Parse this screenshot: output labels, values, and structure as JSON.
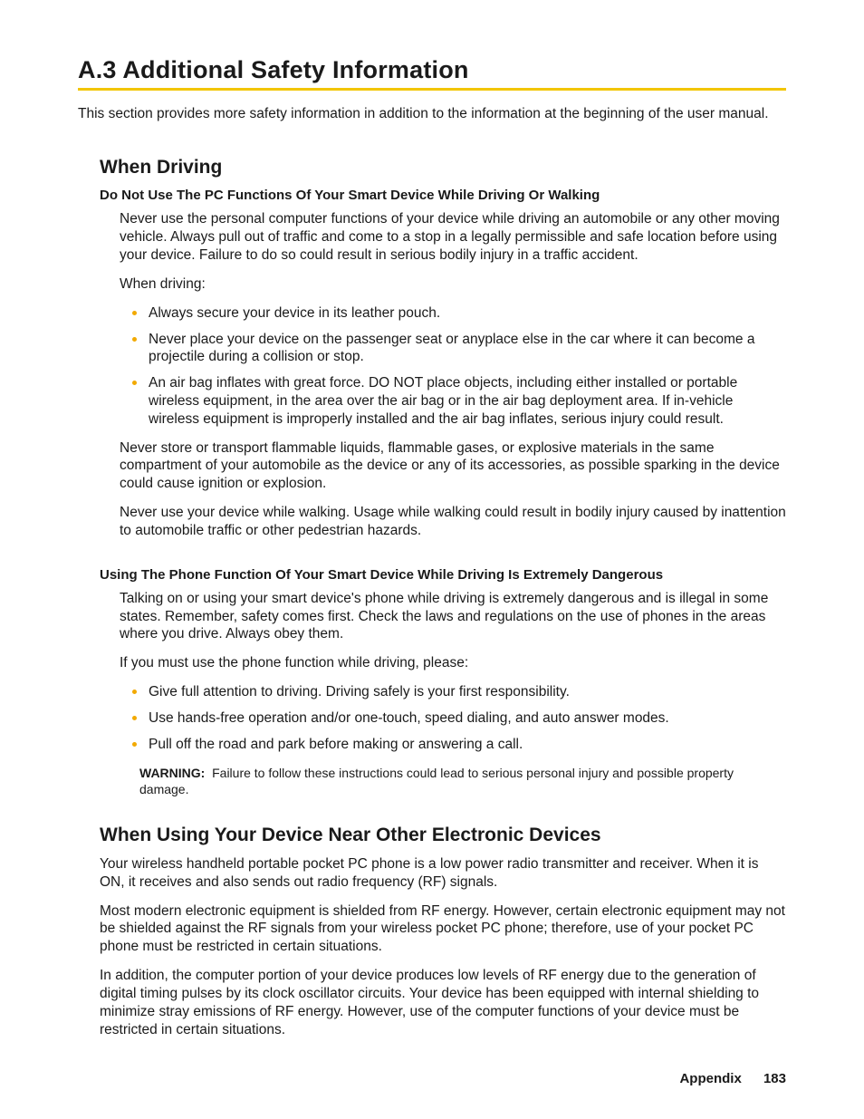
{
  "heading": "A.3  Additional Safety Information",
  "intro": "This section provides more safety information in addition to the information at the beginning of the user manual.",
  "driving": {
    "title": "When Driving",
    "topic1": {
      "heading": "Do Not Use The PC Functions Of Your Smart Device While Driving Or Walking",
      "p1": "Never use the personal computer functions of your device while driving an automobile or any other moving vehicle. Always pull out of traffic and come to a stop in a legally permissible and safe location before using your device. Failure to do so could result in serious bodily injury in a traffic accident.",
      "p2": "When driving:",
      "bullets": [
        "Always secure your device in its leather pouch.",
        "Never place your device on the passenger seat or anyplace else in the car where it can become a projectile during a collision or stop.",
        "An air bag inflates with great force. DO NOT place objects, including either installed or portable wireless equipment, in the area over the air bag or in the air bag deployment area. If in-vehicle wireless equipment is improperly installed and the air bag inflates, serious injury could result."
      ],
      "p3": "Never store or transport flammable liquids, flammable gases, or explosive materials in the same compartment of your automobile as the device or any of its accessories, as possible sparking in the device could cause ignition or explosion.",
      "p4": "Never use your device while walking. Usage while walking could result in bodily injury caused by inattention to automobile traffic or other pedestrian hazards."
    },
    "topic2": {
      "heading": "Using The Phone Function Of Your Smart Device While Driving Is Extremely Dangerous",
      "p1": "Talking on or using your smart device's phone while driving is extremely dangerous and is illegal in some states. Remember, safety comes first. Check the laws and regulations on the use of phones in the areas where you drive. Always obey them.",
      "p2": "If you must use the phone function while driving, please:",
      "bullets": [
        "Give full attention to driving. Driving safely is your first responsibility.",
        "Use hands-free operation and/or one-touch, speed dialing, and auto answer modes.",
        "Pull off the road and park before making or answering a call."
      ],
      "warning_label": "WARNING:",
      "warning_text": "Failure to follow these instructions could lead to serious personal injury and possible property damage."
    }
  },
  "electronic": {
    "title": "When Using Your Device Near Other Electronic Devices",
    "p1": "Your wireless handheld portable pocket PC phone is a low power radio transmitter and receiver. When it is ON, it receives and also sends out radio frequency (RF) signals.",
    "p2": "Most modern electronic equipment is shielded from RF energy. However, certain electronic equipment may not be shielded against the RF signals from your wireless pocket PC phone; therefore, use of your pocket PC phone must be restricted in certain situations.",
    "p3": "In addition, the computer portion of your device produces low levels of RF energy due to the generation of digital timing pulses by its clock oscillator circuits. Your device has been equipped with internal shielding to minimize stray emissions of RF energy. However, use of the computer functions of your device must be restricted in certain situations."
  },
  "footer": {
    "appendix": "Appendix",
    "page": "183"
  }
}
